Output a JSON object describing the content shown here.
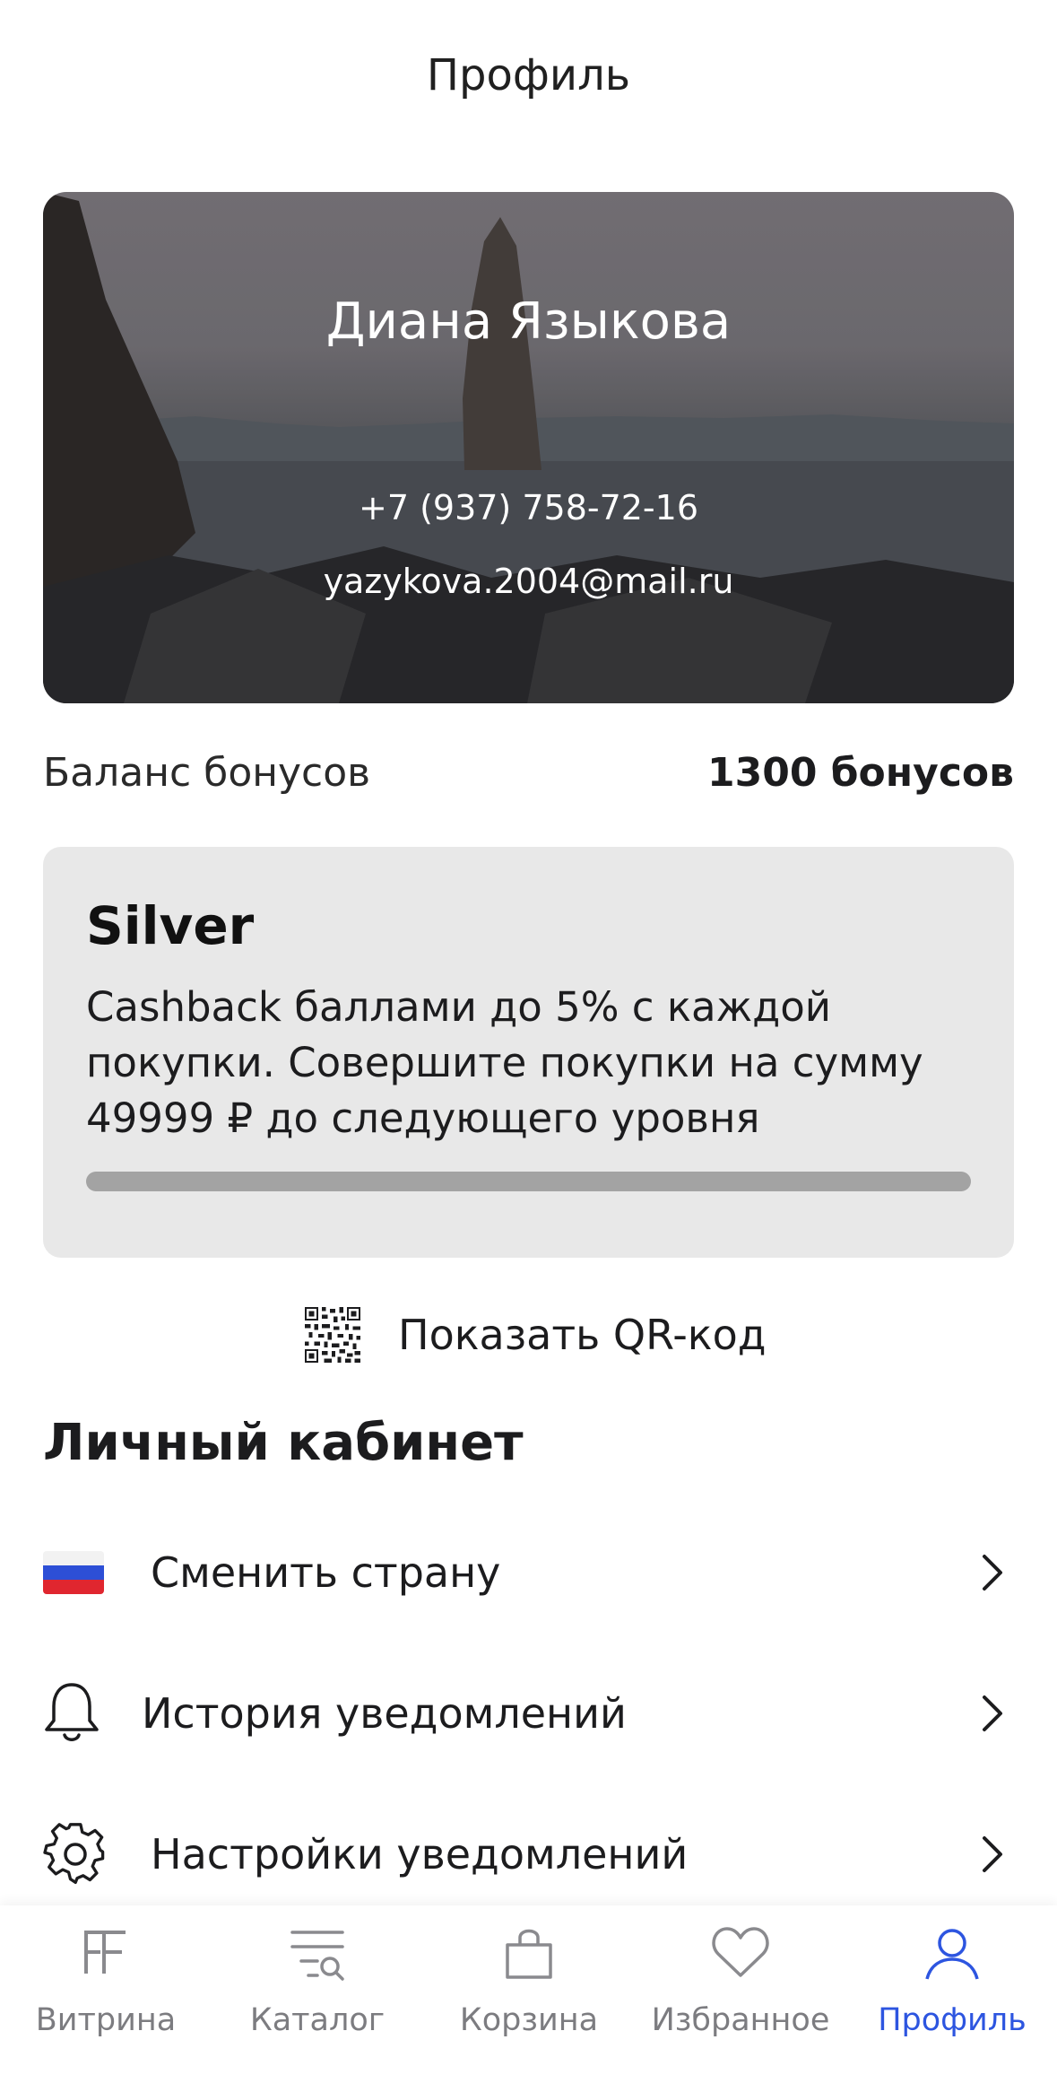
{
  "header": {
    "title": "Профиль"
  },
  "profile": {
    "name": "Диана Языкова",
    "phone": "+7 (937) 758-72-16",
    "email": "yazykova.2004@mail.ru"
  },
  "balance": {
    "label": "Баланс бонусов",
    "value": "1300 бонусов"
  },
  "tier": {
    "name": "Silver",
    "description": "Cashback баллами до 5% с каждой покупки. Совершите покупки на сумму 49999 ₽ до следующего уровня",
    "progress_percent": 0
  },
  "qr": {
    "label": "Показать QR-код",
    "icon": "qr-code-icon"
  },
  "account": {
    "title": "Личный кабинет",
    "items": [
      {
        "label": "Сменить страну",
        "icon": "russia-flag-icon"
      },
      {
        "label": "История уведомлений",
        "icon": "bell-icon"
      },
      {
        "label": "Настройки уведомлений",
        "icon": "gear-icon"
      }
    ]
  },
  "tabbar": {
    "active": "Профиль",
    "active_color": "#2d55e0",
    "items": [
      {
        "label": "Витрина",
        "icon": "storefront-logo-icon"
      },
      {
        "label": "Каталог",
        "icon": "catalog-search-icon"
      },
      {
        "label": "Корзина",
        "icon": "bag-icon"
      },
      {
        "label": "Избранное",
        "icon": "heart-icon"
      },
      {
        "label": "Профиль",
        "icon": "person-icon"
      }
    ]
  }
}
